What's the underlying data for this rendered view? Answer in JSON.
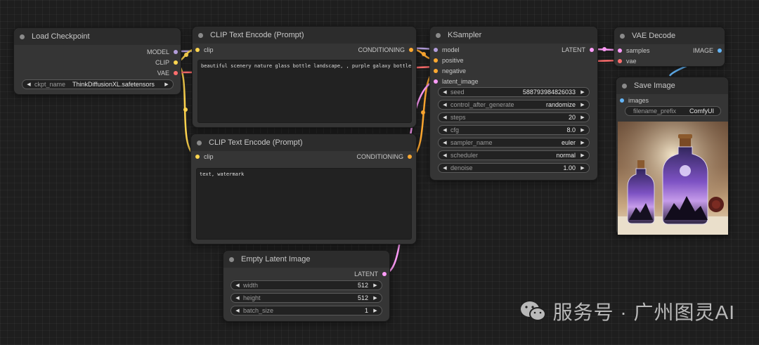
{
  "nodes": {
    "load_checkpoint": {
      "title": "Load Checkpoint",
      "outputs": [
        "MODEL",
        "CLIP",
        "VAE"
      ],
      "widget": {
        "label": "ckpt_name",
        "value": "ThinkDiffusionXL.safetensors"
      }
    },
    "clip_pos": {
      "title": "CLIP Text Encode (Prompt)",
      "input": "clip",
      "output": "CONDITIONING",
      "text": "beautiful scenery nature glass bottle landscape, , purple galaxy bottle,"
    },
    "clip_neg": {
      "title": "CLIP Text Encode (Prompt)",
      "input": "clip",
      "output": "CONDITIONING",
      "text": "text, watermark"
    },
    "ksampler": {
      "title": "KSampler",
      "inputs": [
        "model",
        "positive",
        "negative",
        "latent_image"
      ],
      "output": "LATENT",
      "widgets": [
        {
          "label": "seed",
          "value": "588793984826033"
        },
        {
          "label": "control_after_generate",
          "value": "randomize"
        },
        {
          "label": "steps",
          "value": "20"
        },
        {
          "label": "cfg",
          "value": "8.0"
        },
        {
          "label": "sampler_name",
          "value": "euler"
        },
        {
          "label": "scheduler",
          "value": "normal"
        },
        {
          "label": "denoise",
          "value": "1.00"
        }
      ]
    },
    "vae_decode": {
      "title": "VAE Decode",
      "inputs": [
        "samples",
        "vae"
      ],
      "output": "IMAGE"
    },
    "save_image": {
      "title": "Save Image",
      "input": "images",
      "widget": {
        "label": "filename_prefix",
        "value": "ComfyUI"
      }
    },
    "empty_latent": {
      "title": "Empty Latent Image",
      "output": "LATENT",
      "widgets": [
        {
          "label": "width",
          "value": "512"
        },
        {
          "label": "height",
          "value": "512"
        },
        {
          "label": "batch_size",
          "value": "1"
        }
      ]
    }
  },
  "watermark": {
    "text": "服务号 · 广州图灵AI"
  },
  "colors": {
    "model": "#b39ddb",
    "clip": "#ffd54f",
    "vae": "#ff6e6e",
    "conditioning": "#ffa931",
    "latent": "#ff9cf9",
    "image": "#64b5f6"
  }
}
